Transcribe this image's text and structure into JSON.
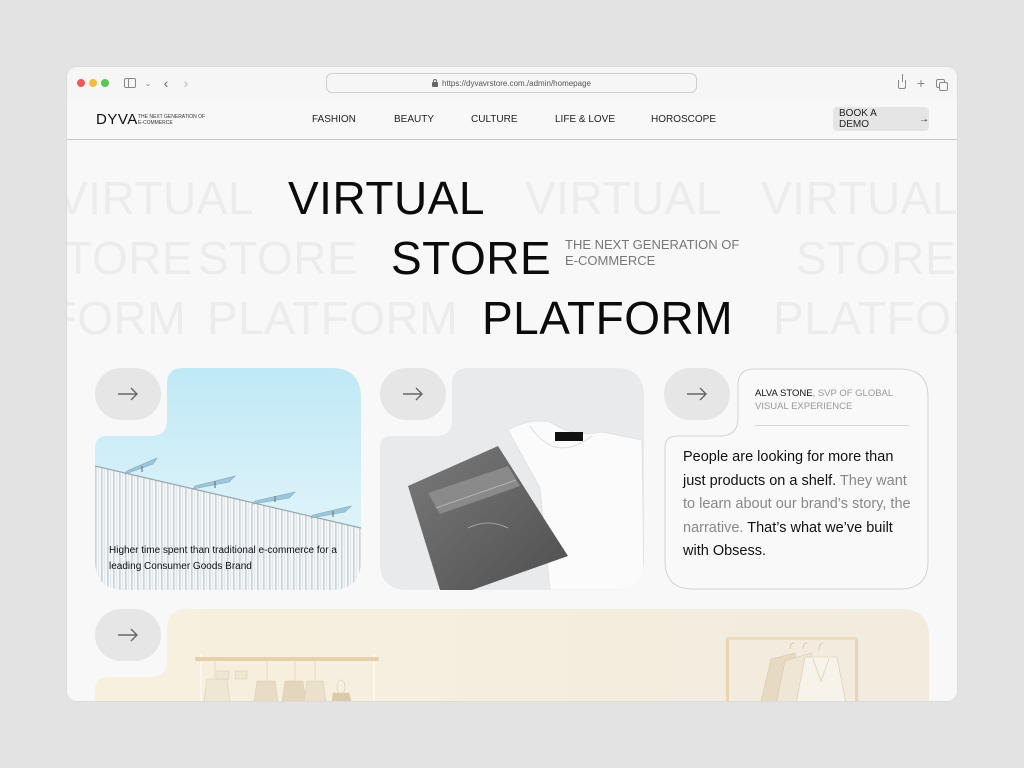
{
  "browser": {
    "url": "https://dyvavrstore.com./admin/homepage",
    "icons": [
      "sidebar-icon",
      "chevron-down-icon",
      "back-icon",
      "forward-icon",
      "lock-icon",
      "share-icon",
      "new-tab-icon",
      "tabs-overview-icon"
    ]
  },
  "header": {
    "logo": "DYVA",
    "logo_tagline": "THE NEXT GENERATION OF E-COMMERCE",
    "nav": [
      {
        "label": "FASHION"
      },
      {
        "label": "BEAUTY"
      },
      {
        "label": "CULTURE"
      },
      {
        "label": "LIFE & LOVE"
      },
      {
        "label": "HOROSCOPE"
      }
    ],
    "cta_label": "BOOK A DEMO",
    "cta_icon": "arrow-right-icon"
  },
  "hero": {
    "words": [
      "VIRTUAL",
      "STORE",
      "PLATFORM"
    ],
    "subtitle_line1": "THE NEXT GENERATION OF",
    "subtitle_line2": "E-COMMERCE"
  },
  "cards": {
    "stat_card": {
      "caption": "Higher time spent than traditional e-commerce for a leading Consumer Goods Brand",
      "image": "solar-panels-on-white-roof"
    },
    "product_card": {
      "image": "folded-grey-jeans-and-white-tshirt"
    },
    "quote_card": {
      "author_name": "ALVA STONE",
      "author_title": ", SVP OF GLOBAL VISUAL EXPERIENCE",
      "quote_part1": "People are looking for more than just products on a shelf.",
      "quote_part2": " They want to learn about our brand’s story, the narrative.",
      "quote_part3": " That’s what we’ve built with Obsess."
    },
    "store_card": {
      "image": "beige-clothing-racks"
    },
    "colors": {
      "page_bg": "#f8f8f8",
      "pill_bg": "#e6e6e6",
      "sky": "#c9ecf6",
      "cream": "#f6efe0"
    }
  }
}
